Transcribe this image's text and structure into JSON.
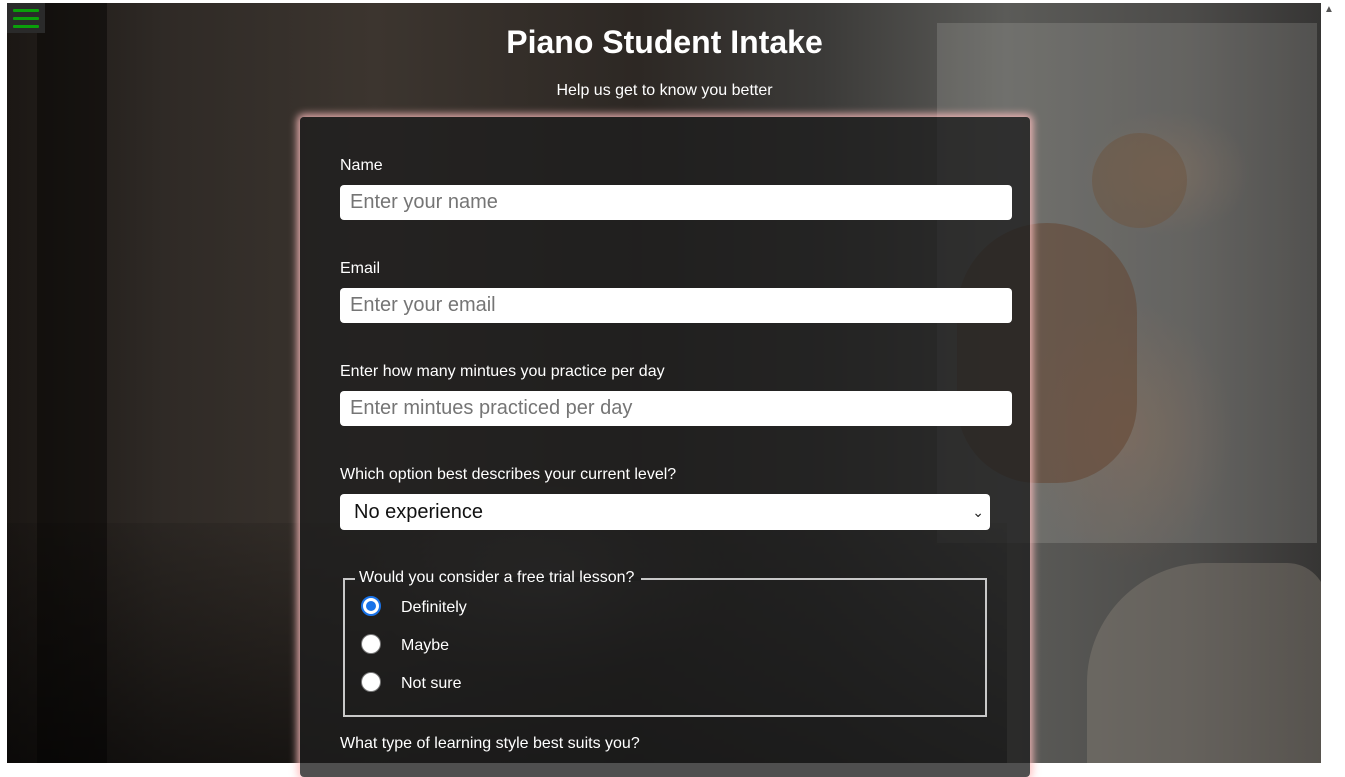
{
  "header": {
    "title": "Piano Student Intake",
    "subtitle": "Help us get to know you better"
  },
  "form": {
    "name": {
      "label": "Name",
      "placeholder": "Enter your name"
    },
    "email": {
      "label": "Email",
      "placeholder": "Enter your email"
    },
    "practice": {
      "label": "Enter how many mintues you practice per day",
      "placeholder": "Enter mintues practiced per day"
    },
    "level": {
      "label": "Which option best describes your current level?",
      "selected": "No experience"
    },
    "trial": {
      "legend": "Would you consider a free trial lesson?",
      "options": [
        "Definitely",
        "Maybe",
        "Not sure"
      ],
      "selected": "Definitely"
    },
    "learning_style": {
      "label": "What type of learning style best suits you?"
    }
  },
  "colors": {
    "accent": "#1a73e8",
    "menu_icon": "#0aa00a",
    "card_glow": "#ffbebe"
  },
  "icons": {
    "menu": "hamburger-menu-icon",
    "select": "chevron-down-icon"
  }
}
